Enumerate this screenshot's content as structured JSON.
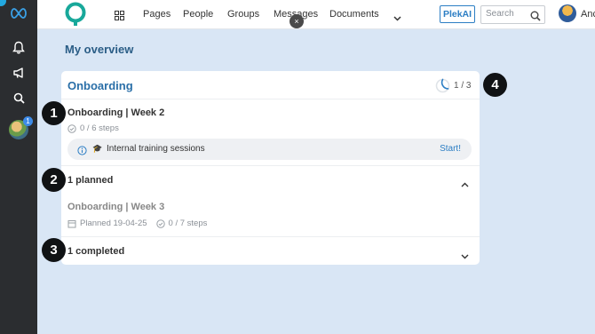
{
  "topbar": {
    "nav": [
      "Pages",
      "People",
      "Groups",
      "Messages",
      "Documents"
    ],
    "close_label": "×",
    "ai_button": "PlekAI",
    "search_placeholder": "Search",
    "user_name": "Anc"
  },
  "rail": {
    "icons": [
      "infinity-icon",
      "bell-icon",
      "megaphone-icon",
      "search-icon",
      "avatar"
    ],
    "avatar_badge": "1"
  },
  "main": {
    "page_title": "My overview",
    "card": {
      "title": "Onboarding",
      "progress": "1 / 3",
      "progress_fraction": 0.33,
      "current": {
        "title": "Onboarding | Week 2",
        "steps": "0 / 6 steps",
        "task": {
          "icon": "🎓",
          "label": "Internal training sessions",
          "action": "Start!"
        }
      },
      "planned": {
        "label": "1 planned",
        "item_title": "Onboarding | Week 3",
        "planned_date": "Planned 19-04-25",
        "steps": "0 / 7 steps"
      },
      "completed": {
        "label": "1 completed"
      }
    }
  },
  "markers": [
    "1",
    "2",
    "3",
    "4"
  ],
  "colors": {
    "rail": "#2b2d30",
    "background": "#d9e6f5",
    "accent": "#2c7ec4",
    "heading": "#2a5d86"
  }
}
